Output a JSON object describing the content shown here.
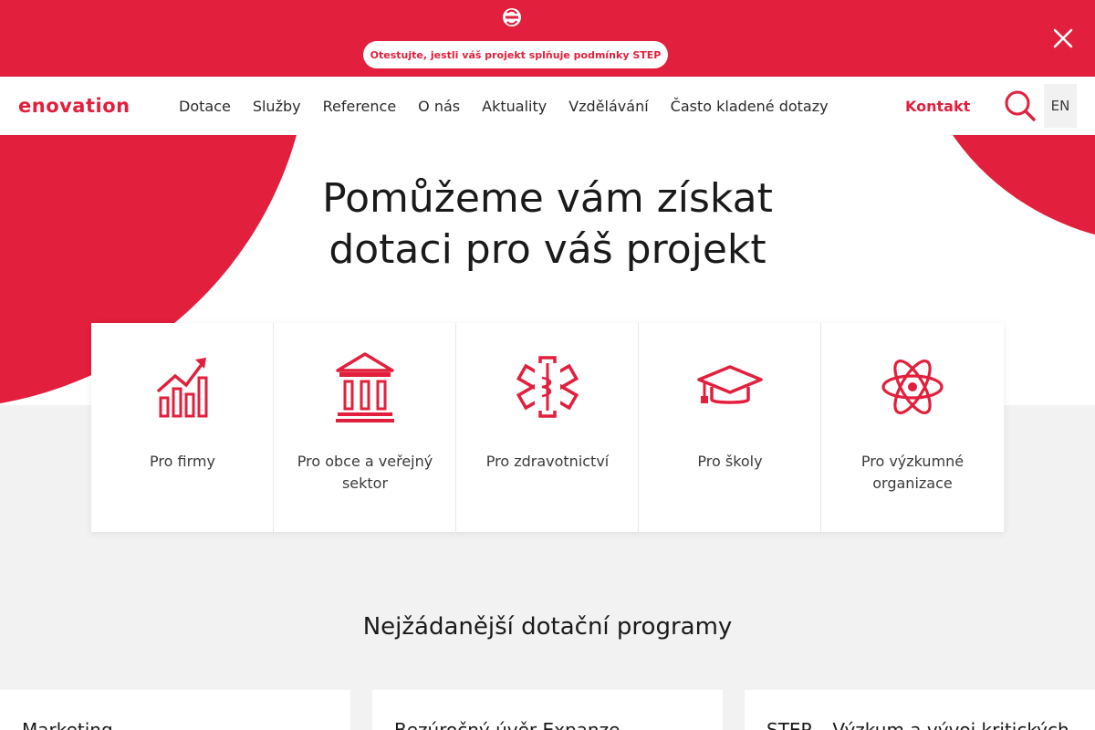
{
  "banner": {
    "cta": "Otestujte, jestli váš projekt splňuje podmínky STEP",
    "logo_icon": "enovation-mark-icon",
    "close_icon": "close-icon"
  },
  "header": {
    "logo_text": "enovation",
    "nav": [
      "Dotace",
      "Služby",
      "Reference",
      "O nás",
      "Aktuality",
      "Vzdělávání",
      "Často kladené dotazy"
    ],
    "contact": "Kontakt",
    "search_icon": "search-icon",
    "lang": "EN"
  },
  "hero": {
    "title_line1": "Pomůžeme vám získat",
    "title_line2": "dotaci pro váš projekt"
  },
  "categories": [
    {
      "label": "Pro firmy",
      "icon": "growth-chart-icon"
    },
    {
      "label": "Pro obce a veřejný sektor",
      "icon": "public-building-icon"
    },
    {
      "label": "Pro zdravotnictví",
      "icon": "medical-star-icon"
    },
    {
      "label": "Pro školy",
      "icon": "graduation-cap-icon"
    },
    {
      "label": "Pro výzkumné organizace",
      "icon": "atom-icon"
    }
  ],
  "programs": {
    "title": "Nejžádanější dotační programy",
    "items": [
      "Marketing",
      "Bezúročný úvěr Expanze",
      "STEP – Výzkum a vývoj kritických"
    ]
  },
  "colors": {
    "accent": "#e21f3c",
    "grey": "#f2f2f2"
  }
}
